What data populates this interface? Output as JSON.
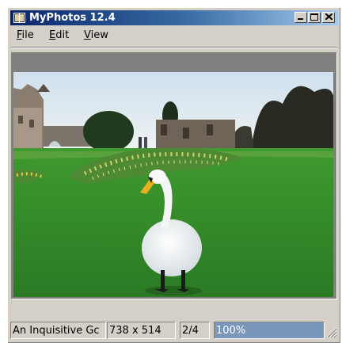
{
  "window": {
    "title": "MyPhotos 12.4",
    "controls": {
      "minimize": "minimize",
      "maximize": "maximize",
      "close": "close"
    }
  },
  "menu": {
    "items": [
      {
        "label": "File",
        "accel": "F",
        "rest": "ile"
      },
      {
        "label": "Edit",
        "accel": "E",
        "rest": "dit"
      },
      {
        "label": "View",
        "accel": "V",
        "rest": "iew"
      }
    ]
  },
  "photo": {
    "subject": "swan-on-lawn",
    "colors": {
      "sky": "#dfe8f0",
      "grass": "#2f8a2a",
      "castle": "#6b6258"
    }
  },
  "status": {
    "caption": "An Inquisitive Gc",
    "dimensions": "738 x 514",
    "position": "2/4",
    "zoom": "100%"
  },
  "icons": {
    "app": "app-photo-icon",
    "grip": "resize-grip-icon"
  }
}
